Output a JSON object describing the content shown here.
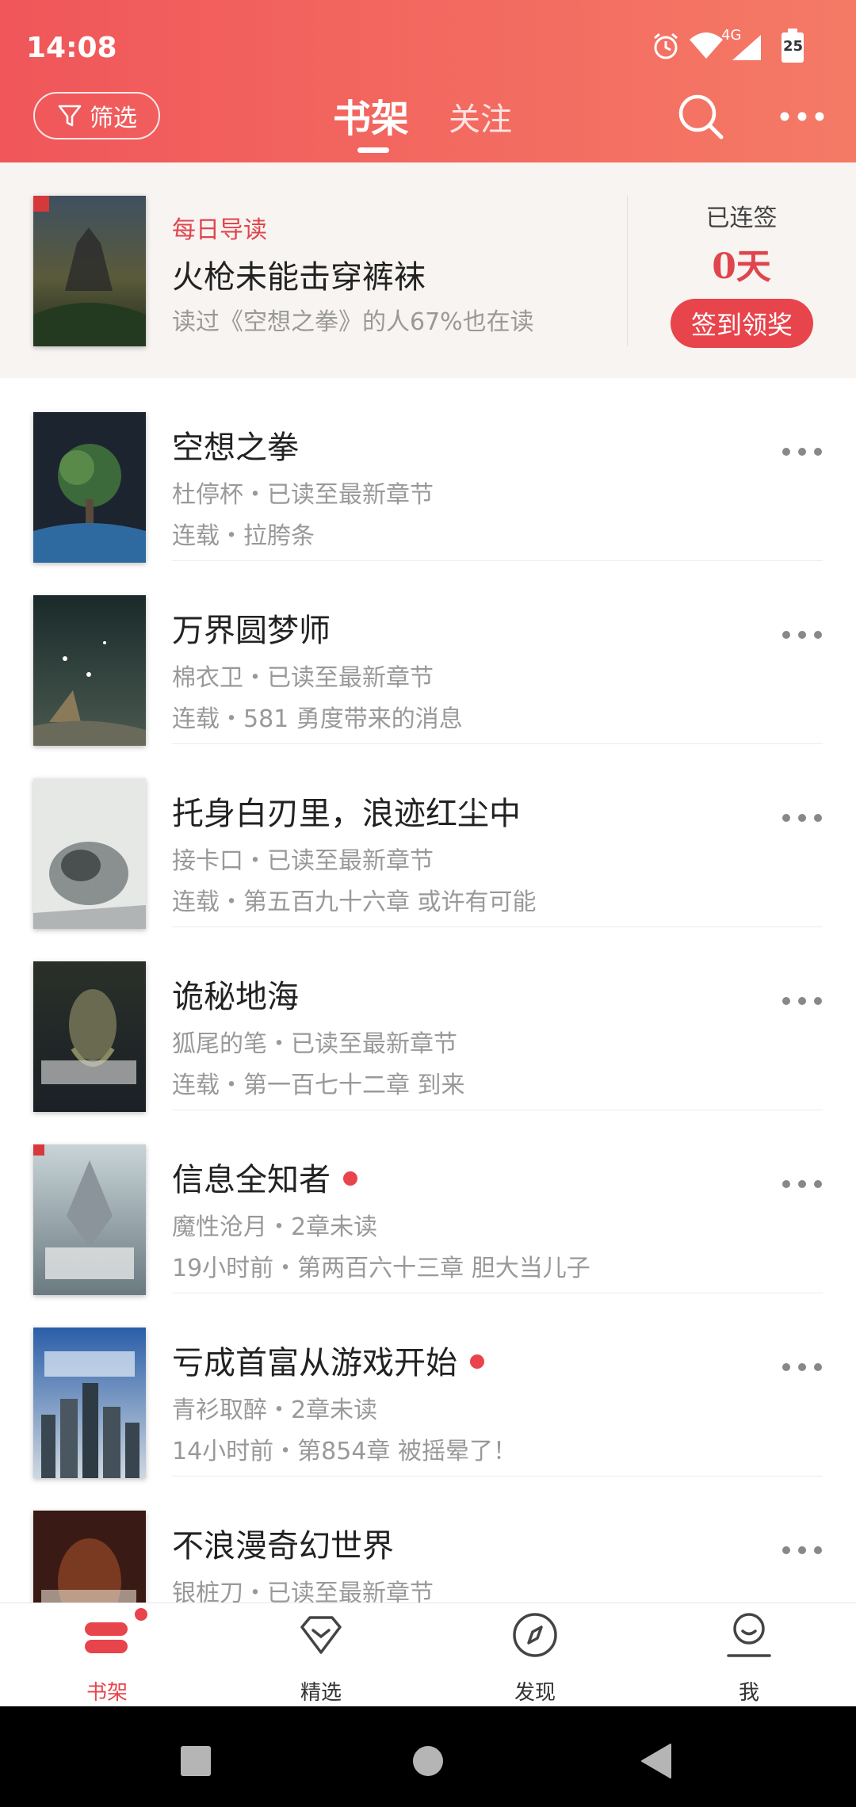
{
  "status_bar": {
    "time": "14:08",
    "network": "4G",
    "battery": "25"
  },
  "header": {
    "filter_label": "筛选",
    "tabs": [
      {
        "label": "书架",
        "active": true
      },
      {
        "label": "关注",
        "active": false
      }
    ]
  },
  "daily": {
    "tag": "每日导读",
    "title": "火枪未能击穿裤袜",
    "subtitle": "读过《空想之拳》的人67%也在读",
    "streak_label": "已连签",
    "streak_value": "0天",
    "checkin_label": "签到领奖"
  },
  "books": [
    {
      "title": "空想之拳",
      "meta1": "杜停杯・已读至最新章节",
      "meta2": "连载・拉胯条",
      "new": false
    },
    {
      "title": "万界圆梦师",
      "meta1": "棉衣卫・已读至最新章节",
      "meta2": "连载・581 勇度带来的消息",
      "new": false
    },
    {
      "title": "托身白刃里，浪迹红尘中",
      "meta1": "接卡口・已读至最新章节",
      "meta2": "连载・第五百九十六章 或许有可能",
      "new": false
    },
    {
      "title": "诡秘地海",
      "meta1": "狐尾的笔・已读至最新章节",
      "meta2": "连载・第一百七十二章 到来",
      "new": false
    },
    {
      "title": "信息全知者",
      "meta1": "魔性沧月・2章未读",
      "meta2": "19小时前・第两百六十三章 胆大当儿子",
      "new": true
    },
    {
      "title": "亏成首富从游戏开始",
      "meta1": "青衫取醉・2章未读",
      "meta2": "14小时前・第854章 被摇晕了！",
      "new": true
    },
    {
      "title": "不浪漫奇幻世界",
      "meta1": "银桩刀・已读至最新章节",
      "meta2": "",
      "new": false
    }
  ],
  "bottom_nav": [
    {
      "label": "书架",
      "icon": "bookshelf-icon",
      "active": true
    },
    {
      "label": "精选",
      "icon": "diamond-icon",
      "active": false
    },
    {
      "label": "发现",
      "icon": "compass-icon",
      "active": false
    },
    {
      "label": "我",
      "icon": "profile-icon",
      "active": false
    }
  ],
  "colors": {
    "accent": "#e8444c",
    "header_start": "#f0565a",
    "header_end": "#f47a66"
  }
}
